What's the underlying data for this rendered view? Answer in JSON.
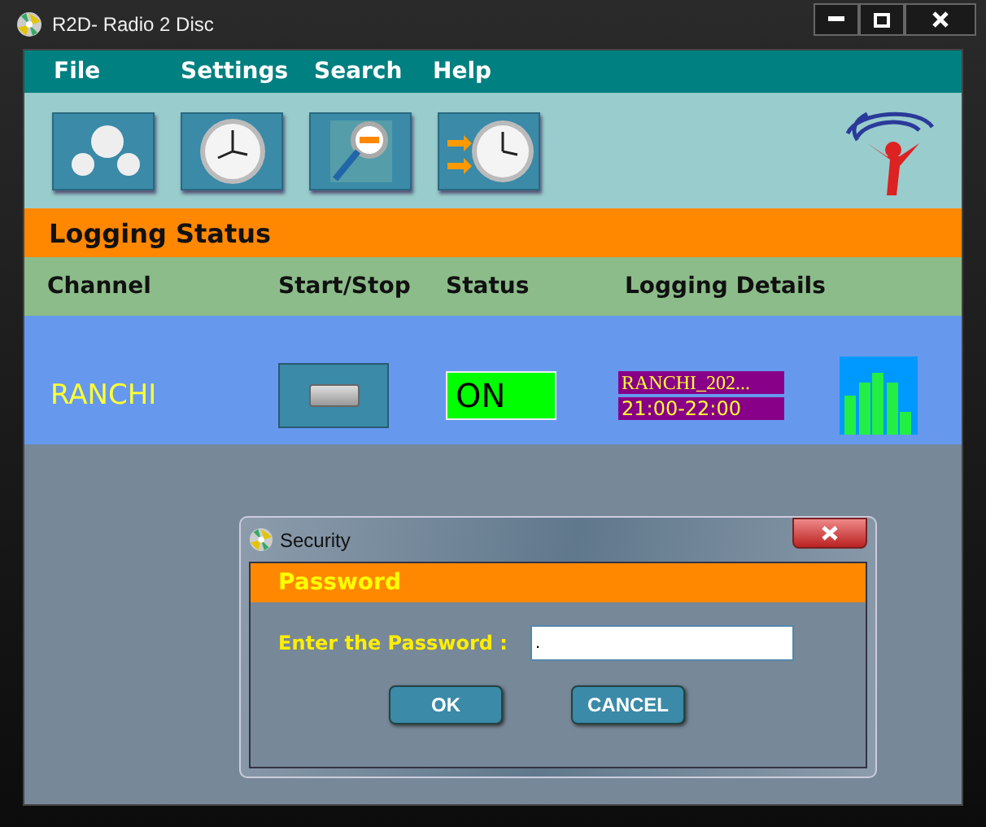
{
  "window": {
    "title": "R2D- Radio 2 Disc"
  },
  "menu": [
    "File",
    "Settings",
    "Search",
    "Help"
  ],
  "section_title": "Logging Status",
  "columns": [
    "Channel",
    "Start/Stop",
    "Status",
    "Logging Details"
  ],
  "channels": [
    {
      "name": "RANCHI",
      "status": "ON",
      "on": true,
      "file": "RANCHI_202...",
      "time": "21:00-22:00"
    }
  ],
  "dialog": {
    "title": "Security",
    "header": "Password",
    "label": "Enter the Password :",
    "value": ".",
    "buttons": [
      "OK",
      "CANCEL"
    ]
  }
}
